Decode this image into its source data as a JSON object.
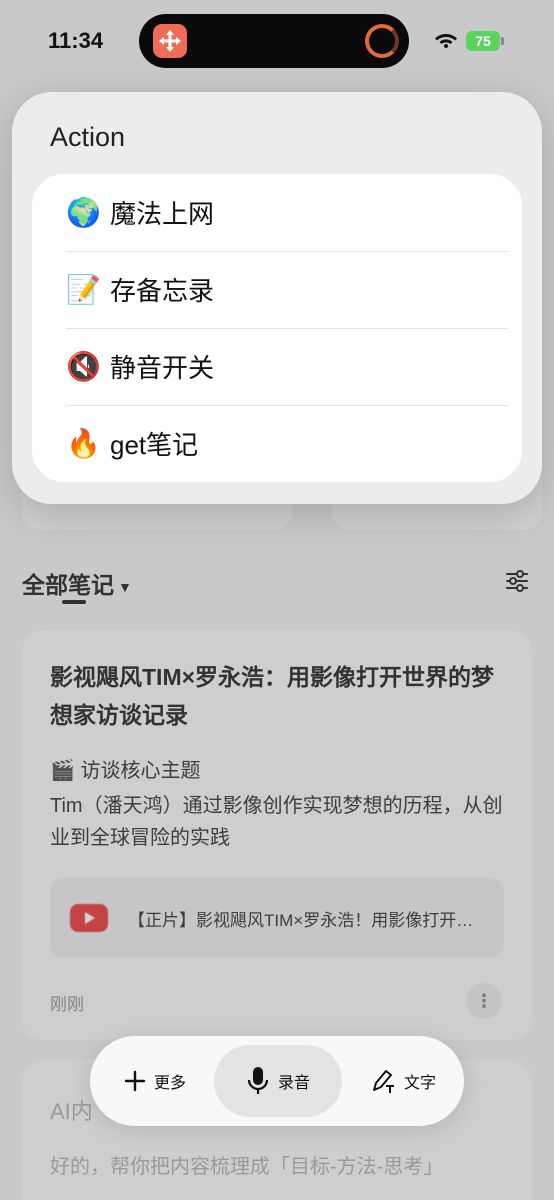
{
  "status_bar": {
    "time": "11:34",
    "battery": "75",
    "battery_color": "#5bd35f"
  },
  "island": {
    "app_icon": "move-arrows-icon",
    "app_color": "#ef6d56"
  },
  "action_panel": {
    "title": "Action",
    "items": [
      {
        "emoji": "🌍",
        "label": "魔法上网"
      },
      {
        "emoji": "📝",
        "label": "存备忘录"
      },
      {
        "emoji": "🔇",
        "label": "静音开关"
      },
      {
        "emoji": "🔥",
        "label": "get笔记"
      }
    ]
  },
  "notes": {
    "section_title": "全部笔记",
    "filter_icon": "sliders-icon"
  },
  "note_card": {
    "title": "影视飓风TIM×罗永浩：用影像打开世界的梦想家访谈记录",
    "subtitle_emoji": "🎬",
    "subtitle": "访谈核心主题",
    "body": "Tim（潘天鸿）通过影像创作实现梦想的历程，从创业到全球冒险的实践",
    "video_icon": "youtube-icon",
    "video_title": "【正片】影视飓风TIM×罗永浩！用影像打开世界的梦想家",
    "time": "刚刚",
    "more_icon": "more-vertical-icon"
  },
  "note_card_2": {
    "title": "AI内",
    "body": "好的，帮你把内容梳理成「目标-方法-思考」"
  },
  "toolbar": {
    "more_label": "更多",
    "record_label": "录音",
    "text_label": "文字"
  }
}
